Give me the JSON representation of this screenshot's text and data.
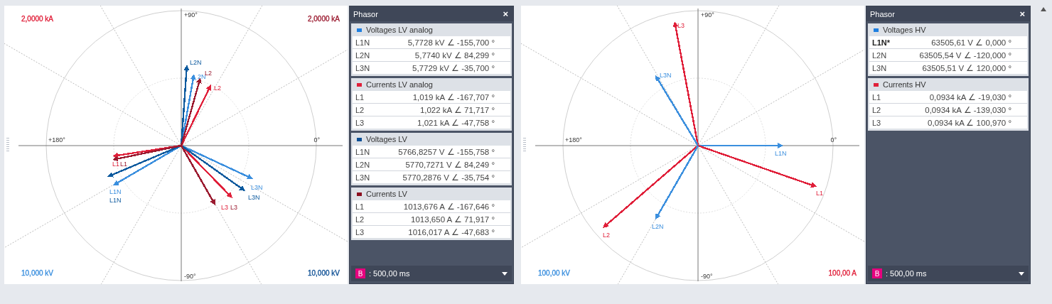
{
  "views": [
    {
      "diagram": {
        "axis_labels": {
          "top": "+90°",
          "left": "+180°",
          "right": "0°",
          "bottom": "-90°"
        },
        "scales": {
          "top_left": {
            "text": "2,0000 kA",
            "color": "#e0203a"
          },
          "top_right": {
            "text": "2,0000 kA",
            "color": "#9b1b30"
          },
          "bottom_left": {
            "text": "10,000 kV",
            "color": "#3b8fde"
          },
          "bottom_right": {
            "text": "10,000 kV",
            "color": "#0d4f94"
          }
        },
        "vectors": [
          {
            "label": "L1N",
            "color": "#3b8fde"
          },
          {
            "label": "2N",
            "color": "#3b8fde"
          },
          {
            "label": "L3N",
            "color": "#3b8fde"
          },
          {
            "label": "L1",
            "color": "#e0203a"
          },
          {
            "label": "L2",
            "color": "#e0203a"
          },
          {
            "label": "L3",
            "color": "#e0203a"
          },
          {
            "label": "L1N",
            "color": "#0d5a9e"
          },
          {
            "label": "L2N",
            "color": "#0d5a9e"
          },
          {
            "label": "L3N",
            "color": "#0d5a9e"
          },
          {
            "label": "L1",
            "color": "#9b1b30"
          },
          {
            "label": "L2",
            "color": "#9b1b30"
          },
          {
            "label": "L3",
            "color": "#9b1b30"
          }
        ]
      },
      "panel": {
        "title": "Phasor",
        "close": "×",
        "groups": [
          {
            "title": "Voltages LV analog",
            "color": "#1e7fe0",
            "rows": [
              {
                "label": "L1N",
                "value": "5,7728 kV ∠ -155,700 °",
                "reference": false
              },
              {
                "label": "L2N",
                "value": "5,7740 kV ∠ 84,299 °",
                "reference": false
              },
              {
                "label": "L3N",
                "value": "5,7729 kV ∠ -35,700 °",
                "reference": false
              }
            ]
          },
          {
            "title": "Currents LV analog",
            "color": "#e0203a",
            "rows": [
              {
                "label": "L1",
                "value": "1,019 kA ∠ -167,707 °",
                "reference": false
              },
              {
                "label": "L2",
                "value": "1,022 kA ∠ 71,717 °",
                "reference": false
              },
              {
                "label": "L3",
                "value": "1,021 kA ∠ -47,758 °",
                "reference": false
              }
            ]
          },
          {
            "title": "Voltages LV",
            "color": "#0d4f94",
            "rows": [
              {
                "label": "L1N",
                "value": "5766,8257 V ∠ -155,758 °",
                "reference": false
              },
              {
                "label": "L2N",
                "value": "5770,7271 V ∠ 84,249 °",
                "reference": false
              },
              {
                "label": "L3N",
                "value": "5770,2876 V ∠ -35,754 °",
                "reference": false
              }
            ]
          },
          {
            "title": "Currents LV",
            "color": "#8b1020",
            "rows": [
              {
                "label": "L1",
                "value": "1013,676 A ∠ -167,646 °",
                "reference": false
              },
              {
                "label": "L2",
                "value": "1013,650 A ∠ 71,917 °",
                "reference": false
              },
              {
                "label": "L3",
                "value": "1016,017 A ∠ -47,683 °",
                "reference": false
              }
            ]
          }
        ],
        "footer": {
          "badge": "B",
          "time": ": 500,00 ms"
        }
      }
    },
    {
      "diagram": {
        "axis_labels": {
          "top": "+90°",
          "left": "+180°",
          "right": "0°",
          "bottom": "-90°"
        },
        "scales": {
          "bottom_left": {
            "text": "100,00 kV",
            "color": "#3b8fde"
          },
          "bottom_right": {
            "text": "100,00 A",
            "color": "#e0203a"
          }
        },
        "vectors": [
          {
            "label": "L3",
            "color": "#e0203a"
          },
          {
            "label": "L3N",
            "color": "#3b8fde"
          },
          {
            "label": "L1N",
            "color": "#3b8fde"
          },
          {
            "label": "L1",
            "color": "#e0203a"
          },
          {
            "label": "L2",
            "color": "#e0203a"
          },
          {
            "label": "L2N",
            "color": "#3b8fde"
          }
        ]
      },
      "panel": {
        "title": "Phasor",
        "close": "×",
        "groups": [
          {
            "title": "Voltages HV",
            "color": "#1e7fe0",
            "rows": [
              {
                "label": "L1N*",
                "value": "63505,61 V ∠ 0,000 °",
                "reference": true
              },
              {
                "label": "L2N",
                "value": "63505,54 V ∠ -120,000 °",
                "reference": false
              },
              {
                "label": "L3N",
                "value": "63505,51 V ∠ 120,000 °",
                "reference": false
              }
            ]
          },
          {
            "title": "Currents HV",
            "color": "#e0203a",
            "rows": [
              {
                "label": "L1",
                "value": "0,0934 kA ∠ -19,030 °",
                "reference": false
              },
              {
                "label": "L2",
                "value": "0,0934 kA ∠ -139,030 °",
                "reference": false
              },
              {
                "label": "L3",
                "value": "0,0934 kA ∠ 100,970 °",
                "reference": false
              }
            ]
          }
        ],
        "footer": {
          "badge": "B",
          "time": ": 500,00 ms"
        }
      }
    }
  ]
}
